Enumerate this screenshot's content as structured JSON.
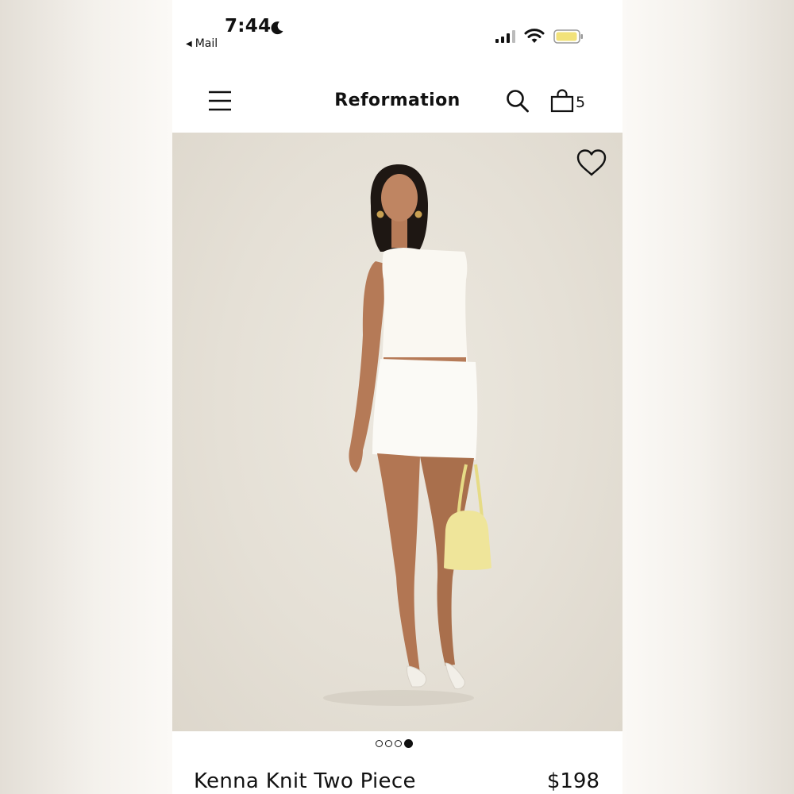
{
  "status_bar": {
    "time": "7:44",
    "back_label": "Mail",
    "back_arrow": "◀"
  },
  "header": {
    "brand": "Reformation",
    "cart_count": "5"
  },
  "product": {
    "name": "Kenna Knit Two Piece",
    "price": "$198"
  },
  "carousel": {
    "total": 4,
    "active_index": 3
  },
  "icons": {
    "menu": "menu-icon",
    "search": "search-icon",
    "bag": "bag-icon",
    "heart": "heart-icon",
    "moon": "moon-icon",
    "signal": "signal-icon",
    "wifi": "wifi-icon",
    "battery": "battery-icon"
  },
  "colors": {
    "text": "#111111",
    "battery_fill": "#f2e27a",
    "backdrop": "#e5e0d6",
    "bag_yellow": "#efe59a"
  }
}
